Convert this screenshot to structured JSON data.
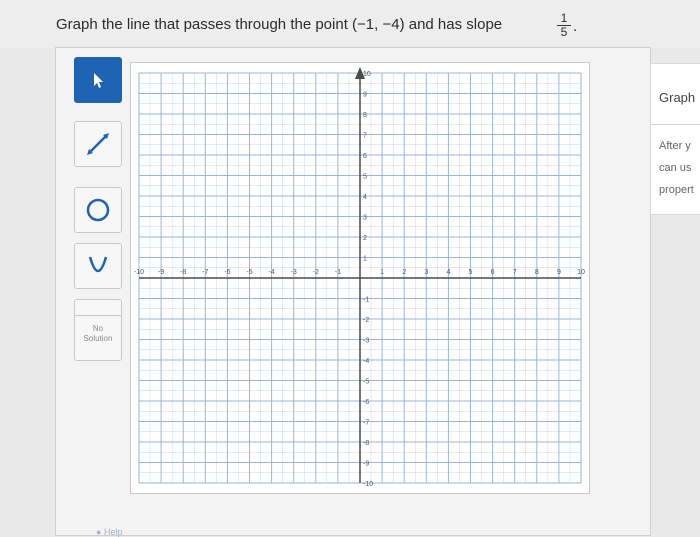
{
  "question": {
    "text": "Graph the line that passes through the point (−1, −4) and has slope",
    "slope_numerator": "1",
    "slope_denominator": "5",
    "period": "."
  },
  "toolbar": {
    "tools": [
      {
        "name": "pointer-tool",
        "icon": "arrow-cursor-icon",
        "active": true
      },
      {
        "name": "line-tool",
        "icon": "line-segment-icon",
        "active": false
      },
      {
        "name": "circle-tool",
        "icon": "circle-icon",
        "active": false
      },
      {
        "name": "parabola-tool",
        "icon": "parabola-icon",
        "active": false
      },
      {
        "name": "point-tool",
        "icon": "dot-icon",
        "active": false
      }
    ],
    "no_solution_line1": "No",
    "no_solution_line2": "Solution",
    "help_label": "Help"
  },
  "graph": {
    "x_range": [
      -10,
      10
    ],
    "y_range": [
      -10,
      10
    ],
    "grid": true,
    "minor_step": 0.5,
    "x_tick_labels": [
      "-10",
      "-9",
      "-8",
      "-7",
      "-6",
      "-5",
      "-4",
      "-3",
      "-2",
      "-1",
      "1",
      "2",
      "3",
      "4",
      "5",
      "6",
      "7",
      "8",
      "9",
      "10"
    ],
    "y_tick_labels": [
      "10",
      "9",
      "8",
      "7",
      "6",
      "5",
      "4",
      "3",
      "2",
      "1",
      "-1",
      "-2",
      "-3",
      "-4",
      "-5",
      "-6",
      "-7",
      "-8",
      "-9",
      "-10"
    ],
    "accent_color": "#1e63b4",
    "axis_color": "#4a4a4a",
    "grid_color": "#8fb0d6"
  },
  "side_panel": {
    "title": "Graph",
    "lines": [
      "After y",
      "can us",
      "propert"
    ]
  }
}
